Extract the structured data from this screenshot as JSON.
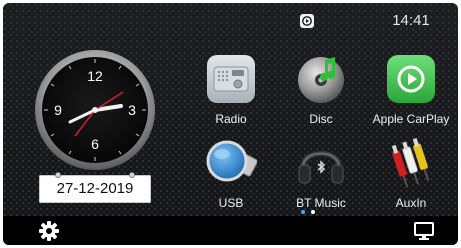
{
  "status": {
    "time": "14:41",
    "carplay_indicator_icon": "carplay-icon"
  },
  "clock": {
    "numerals": [
      "12",
      "3",
      "6",
      "9"
    ],
    "date": "27-12-2019"
  },
  "apps": [
    {
      "label": "Radio",
      "icon": "radio-icon"
    },
    {
      "label": "Disc",
      "icon": "disc-icon"
    },
    {
      "label": "Apple CarPlay",
      "icon": "carplay-icon"
    },
    {
      "label": "USB",
      "icon": "usb-icon"
    },
    {
      "label": "BT Music",
      "icon": "headphones-icon"
    },
    {
      "label": "AuxIn",
      "icon": "rca-cable-icon"
    }
  ],
  "pager": {
    "count": 2,
    "active": 1
  },
  "bottom_bar": {
    "left_icon": "gear-icon",
    "right_icon": "monitor-icon"
  },
  "colors": {
    "carplay_green": "#3fc84f",
    "radio_grey": "#c9d0d6",
    "usb_blue": "#2c8ad6",
    "second_hand": "#d0202a"
  }
}
